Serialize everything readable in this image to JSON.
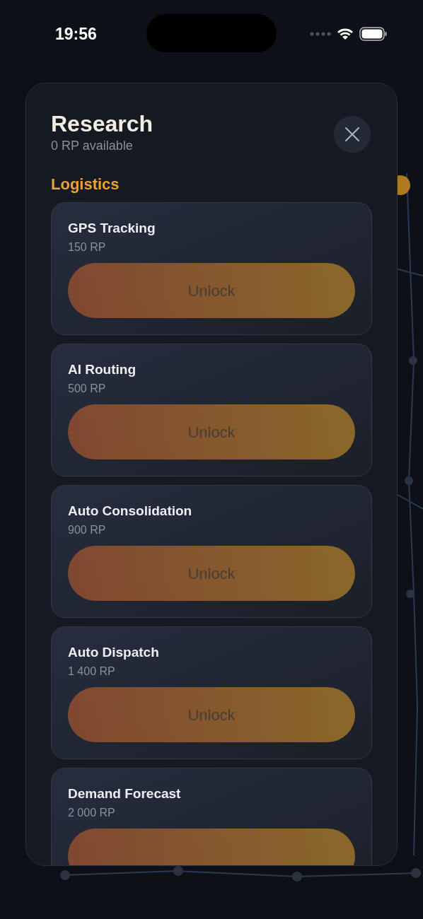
{
  "status_bar": {
    "time": "19:56"
  },
  "panel": {
    "title": "Research",
    "subtitle": "0 RP available"
  },
  "sections": [
    {
      "title": "Logistics",
      "items": [
        {
          "name": "GPS Tracking",
          "cost": "150 RP",
          "button": "Unlock",
          "disabled": true
        },
        {
          "name": "AI Routing",
          "cost": "500 RP",
          "button": "Unlock",
          "disabled": true
        },
        {
          "name": "Auto Consolidation",
          "cost": "900 RP",
          "button": "Unlock",
          "disabled": true
        },
        {
          "name": "Auto Dispatch",
          "cost": "1 400 RP",
          "button": "Unlock",
          "disabled": true
        },
        {
          "name": "Demand Forecast",
          "cost": "2 000 RP",
          "disabled": true
        }
      ]
    }
  ]
}
